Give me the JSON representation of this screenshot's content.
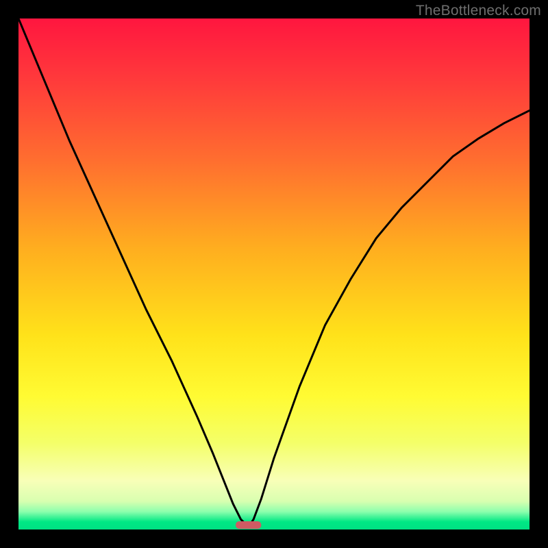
{
  "watermark": "TheBottleneck.com",
  "colors": {
    "frame": "#000000",
    "curve": "#000000",
    "marker_fill": "#cf5b63",
    "gradient_stops": [
      {
        "offset": 0.0,
        "color": "#ff163f"
      },
      {
        "offset": 0.12,
        "color": "#ff3a3b"
      },
      {
        "offset": 0.28,
        "color": "#ff6f2f"
      },
      {
        "offset": 0.45,
        "color": "#ffae1f"
      },
      {
        "offset": 0.62,
        "color": "#ffe21a"
      },
      {
        "offset": 0.74,
        "color": "#fffb33"
      },
      {
        "offset": 0.83,
        "color": "#f4ff68"
      },
      {
        "offset": 0.905,
        "color": "#f8ffb8"
      },
      {
        "offset": 0.945,
        "color": "#d8ffb0"
      },
      {
        "offset": 0.965,
        "color": "#8dffad"
      },
      {
        "offset": 0.985,
        "color": "#00e884"
      },
      {
        "offset": 1.0,
        "color": "#00e183"
      }
    ]
  },
  "chart_data": {
    "type": "line",
    "title": "",
    "xlabel": "",
    "ylabel": "",
    "xlim": [
      0,
      100
    ],
    "ylim": [
      0,
      100
    ],
    "grid": false,
    "legend": false,
    "series": [
      {
        "name": "curve",
        "x": [
          0,
          5,
          10,
          15,
          20,
          25,
          30,
          35,
          38,
          40,
          42,
          43.5,
          45,
          46,
          47.5,
          50,
          55,
          60,
          65,
          70,
          75,
          80,
          85,
          90,
          95,
          100
        ],
        "y": [
          100,
          88,
          76,
          65,
          54,
          43,
          33,
          22,
          15,
          10,
          5,
          2,
          0.5,
          2,
          6,
          14,
          28,
          40,
          49,
          57,
          63,
          68,
          73,
          76.5,
          79.5,
          82
        ]
      }
    ],
    "marker": {
      "x_center": 45.0,
      "width": 5.0,
      "y": 0.5
    }
  }
}
